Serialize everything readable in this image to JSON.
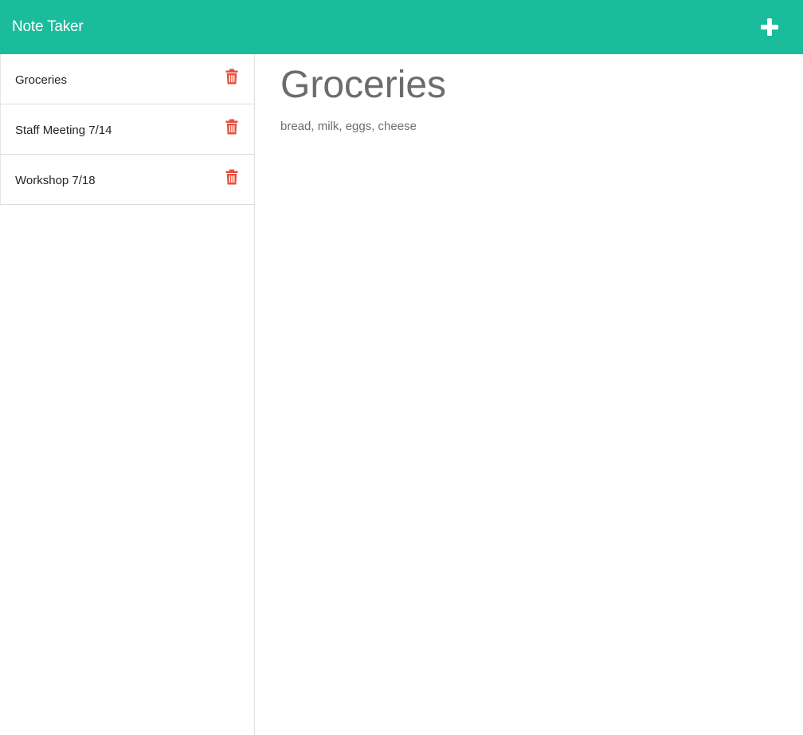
{
  "app": {
    "brand": "Note Taker",
    "accent_color": "#1abc9c",
    "delete_color": "#e74c3c",
    "add_icon": "plus-icon"
  },
  "notes": [
    {
      "title": "Groceries",
      "icon": "trash-icon"
    },
    {
      "title": "Staff Meeting 7/14",
      "icon": "trash-icon"
    },
    {
      "title": "Workshop 7/18",
      "icon": "trash-icon"
    }
  ],
  "active_note": {
    "title": "Groceries",
    "text": "bread, milk, eggs, cheese"
  }
}
